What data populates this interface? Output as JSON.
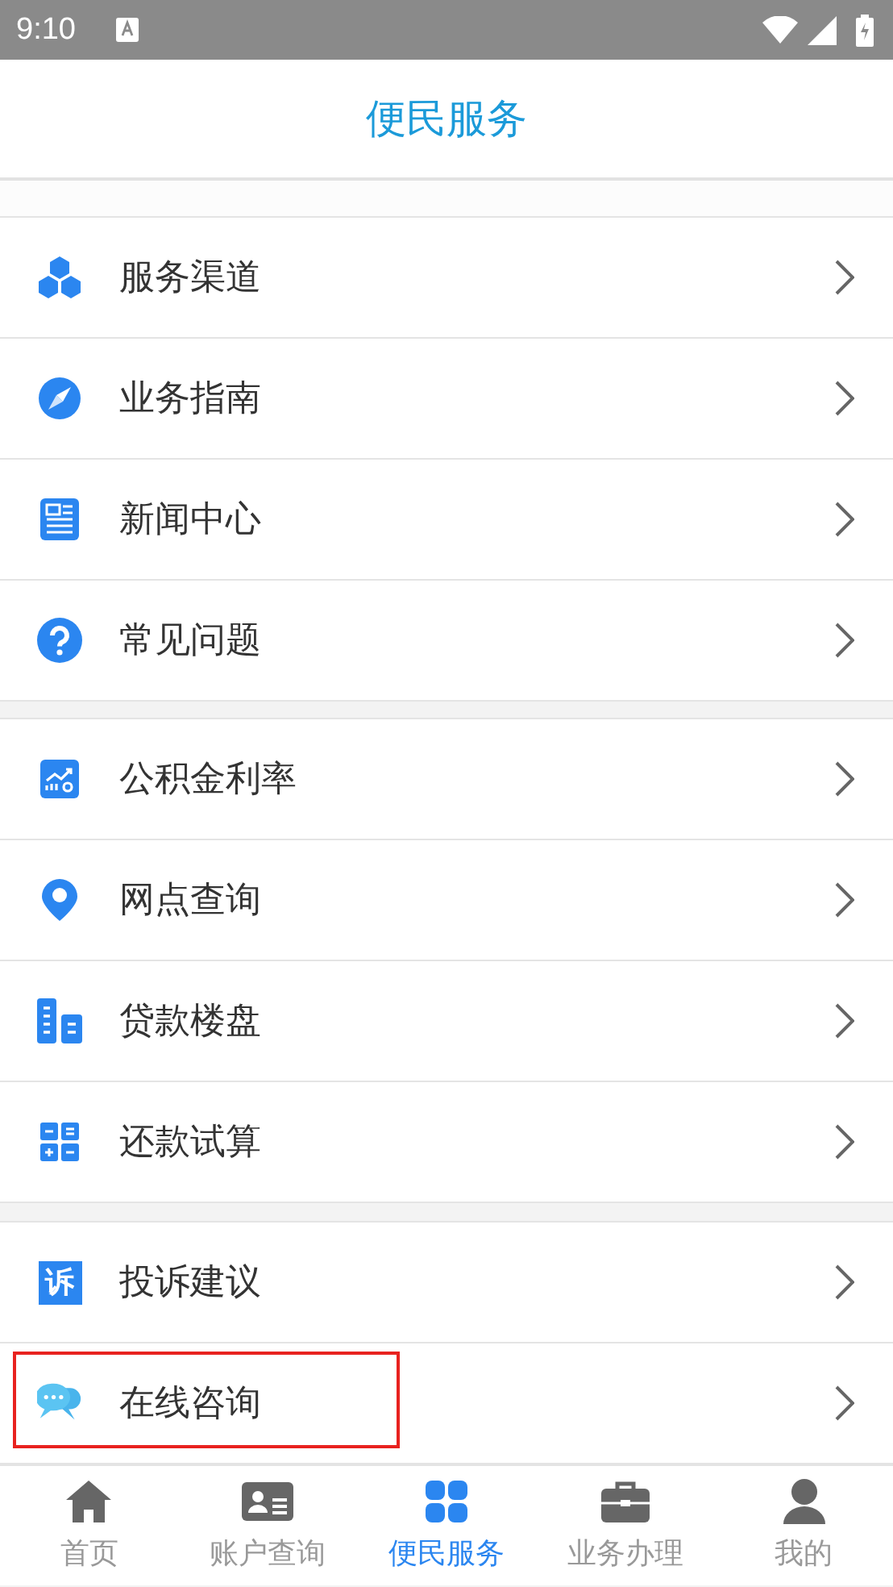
{
  "status_bar": {
    "time": "9:10"
  },
  "header": {
    "title": "便民服务"
  },
  "groups": [
    {
      "items": [
        {
          "label": "服务渠道",
          "highlighted": false
        },
        {
          "label": "业务指南",
          "highlighted": false
        },
        {
          "label": "新闻中心",
          "highlighted": false
        },
        {
          "label": "常见问题",
          "highlighted": false
        }
      ]
    },
    {
      "items": [
        {
          "label": "公积金利率",
          "highlighted": false
        },
        {
          "label": "网点查询",
          "highlighted": false
        },
        {
          "label": "贷款楼盘",
          "highlighted": false
        },
        {
          "label": "还款试算",
          "highlighted": false
        }
      ]
    },
    {
      "items": [
        {
          "label": "投诉建议",
          "highlighted": false,
          "icon_text": "诉"
        },
        {
          "label": "在线咨询",
          "highlighted": true
        }
      ]
    }
  ],
  "tabs": [
    {
      "label": "首页",
      "selected": false
    },
    {
      "label": "账户查询",
      "selected": false
    },
    {
      "label": "便民服务",
      "selected": true
    },
    {
      "label": "业务办理",
      "selected": false
    },
    {
      "label": "我的",
      "selected": false
    }
  ]
}
